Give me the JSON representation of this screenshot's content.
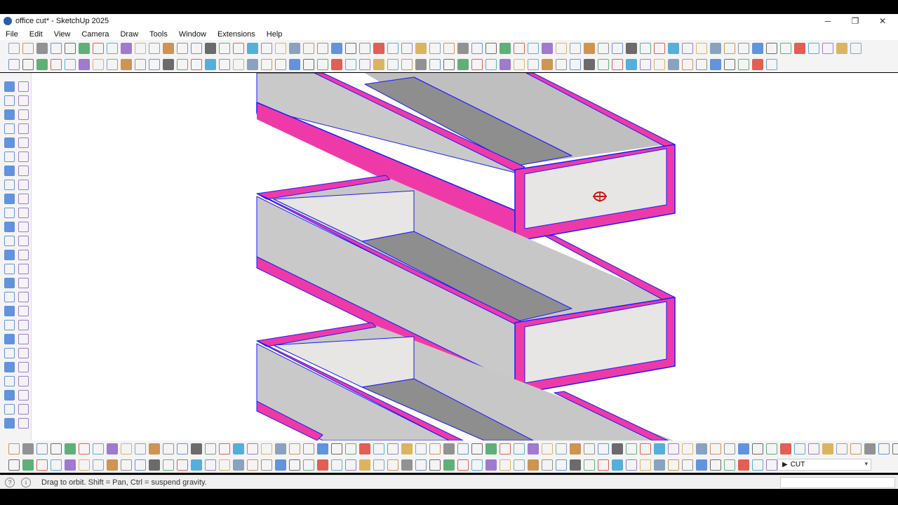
{
  "window": {
    "title": "office cut* - SketchUp 2025",
    "minimize_glyph": "─",
    "restore_glyph": "❐",
    "close_glyph": "✕"
  },
  "menu": {
    "items": [
      "File",
      "Edit",
      "View",
      "Camera",
      "Draw",
      "Tools",
      "Window",
      "Extensions",
      "Help"
    ]
  },
  "tag_selector": {
    "value": "CUT",
    "chevron": "▾"
  },
  "status": {
    "message": "Drag to orbit. Shift = Pan, Ctrl = suspend gravity.",
    "help_icon": "?",
    "info_icon": "i"
  },
  "colors": {
    "face_light": "#e7e6e4",
    "face_mid": "#c7c7c7",
    "face_dark": "#8e8e8e",
    "section_cut": "#ee3aa8",
    "selected_edge": "#1a1aff",
    "viewport_bg": "#ffffff"
  }
}
